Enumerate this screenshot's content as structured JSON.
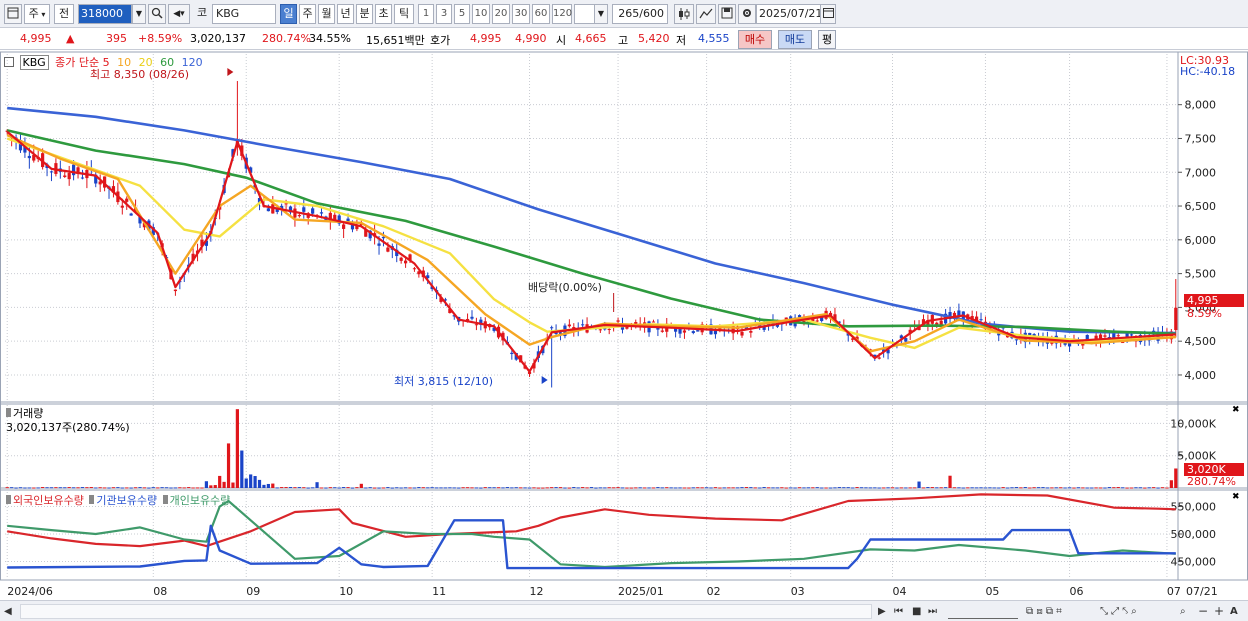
{
  "toolbar": {
    "period_primary": "주",
    "prev_label": "전",
    "code_value": "318000",
    "stock_prefix": "코",
    "stock_name": "KBG",
    "periods": [
      "일",
      "주",
      "월",
      "년",
      "분",
      "초",
      "틱"
    ],
    "active_period": "일",
    "intervals": [
      "1",
      "3",
      "5",
      "10",
      "20",
      "30",
      "60",
      "120"
    ],
    "count_value": "265",
    "count_total": "/600",
    "date_value": "2025/07/21"
  },
  "quote": {
    "price": "4,995",
    "change_arrow": "▲",
    "change": "395",
    "change_pct": "+8.59%",
    "volume": "3,020,137",
    "volume_ratio": "280.74%",
    "turnover_pct": "34.55%",
    "amount": "15,651백만",
    "bid_label": "호가",
    "ask_price": "4,995",
    "bid_price": "4,990",
    "open_label": "시",
    "open": "4,665",
    "high_label": "고",
    "high": "5,420",
    "low_label": "저",
    "low": "4,555",
    "buy_label": "매수",
    "sell_label": "매도",
    "eval_label": "평"
  },
  "price_pane": {
    "tag": "KBG",
    "legend_title": "종가 단순",
    "ma_periods": [
      "5",
      "10",
      "20",
      "60",
      "120"
    ],
    "high_note": "최고 8,350 (08/26)",
    "low_note": "최저 3,815 (12/10)",
    "dividend_note": "배당락(0.00%)",
    "lc": "LC:30.93",
    "hc": "HC:-40.18",
    "current_price": "4,995",
    "current_pct": "8.59%"
  },
  "volume_pane": {
    "title": "거래량",
    "value_note": "3,020,137주(280.74%)",
    "current_value": "3,020K",
    "current_pct": "280.74%"
  },
  "holding_pane": {
    "labels": [
      "외국인보유수량",
      "기관보유수량",
      "개인보유수량"
    ]
  },
  "colors": {
    "up": "#e0161b",
    "down": "#1a44c8",
    "ma5": "#e0161b",
    "ma10": "#f5a623",
    "ma20": "#f5e142",
    "ma60": "#2e9a3e",
    "ma120": "#3a63d6",
    "foreign": "#d9262b",
    "institution": "#2a54d0",
    "individual": "#3f9a6a"
  },
  "chart_data": {
    "type": "candlestick",
    "symbol": "KBG",
    "x_labels": [
      "2024/06",
      "08",
      "09",
      "10",
      "11",
      "12",
      "2025/01",
      "02",
      "03",
      "04",
      "05",
      "06",
      "07",
      "07/21"
    ],
    "price_axis": {
      "ticks": [
        4000,
        4500,
        5000,
        5500,
        6000,
        6500,
        7000,
        7500,
        8000
      ],
      "tick_labels": [
        "4,000",
        "4,500",
        "5,000",
        "5,500",
        "6,000",
        "6,500",
        "7,000",
        "7,500",
        "8,000"
      ],
      "range": [
        3600,
        8750
      ]
    },
    "volume_axis": {
      "ticks": [
        5000,
        10000
      ],
      "tick_labels": [
        "5,000K",
        "10,000K"
      ],
      "range": [
        0,
        13000
      ]
    },
    "holding_axis": {
      "ticks": [
        450000,
        500000,
        550000
      ],
      "tick_labels": [
        "450,000",
        "500,000",
        "550,000"
      ],
      "range": [
        420000,
        580000
      ]
    },
    "month_bar_index": [
      0,
      33,
      54,
      75,
      96,
      118,
      138,
      158,
      177,
      200,
      221,
      240,
      262
    ],
    "ma120": [
      [
        0,
        7950
      ],
      [
        20,
        7820
      ],
      [
        40,
        7620
      ],
      [
        60,
        7380
      ],
      [
        80,
        7150
      ],
      [
        100,
        6900
      ],
      [
        120,
        6450
      ],
      [
        140,
        6050
      ],
      [
        160,
        5650
      ],
      [
        180,
        5360
      ],
      [
        200,
        5040
      ],
      [
        220,
        4760
      ],
      [
        240,
        4640
      ],
      [
        264,
        4620
      ]
    ],
    "ma60": [
      [
        0,
        7620
      ],
      [
        20,
        7320
      ],
      [
        40,
        7120
      ],
      [
        54,
        6920
      ],
      [
        70,
        6540
      ],
      [
        90,
        6280
      ],
      [
        110,
        5900
      ],
      [
        130,
        5500
      ],
      [
        150,
        5130
      ],
      [
        170,
        4820
      ],
      [
        190,
        4720
      ],
      [
        210,
        4730
      ],
      [
        230,
        4710
      ],
      [
        250,
        4640
      ],
      [
        264,
        4610
      ]
    ],
    "ma20": [
      [
        0,
        7500
      ],
      [
        15,
        7150
      ],
      [
        30,
        6800
      ],
      [
        40,
        6150
      ],
      [
        48,
        6050
      ],
      [
        58,
        6600
      ],
      [
        70,
        6500
      ],
      [
        85,
        6200
      ],
      [
        100,
        5800
      ],
      [
        110,
        5120
      ],
      [
        118,
        4780
      ],
      [
        122,
        4640
      ],
      [
        130,
        4680
      ],
      [
        145,
        4750
      ],
      [
        160,
        4720
      ],
      [
        180,
        4820
      ],
      [
        195,
        4550
      ],
      [
        205,
        4400
      ],
      [
        215,
        4700
      ],
      [
        230,
        4580
      ],
      [
        245,
        4500
      ],
      [
        264,
        4560
      ]
    ],
    "ma10": [
      [
        0,
        7550
      ],
      [
        12,
        7200
      ],
      [
        25,
        6900
      ],
      [
        38,
        5500
      ],
      [
        48,
        6500
      ],
      [
        55,
        6800
      ],
      [
        65,
        6300
      ],
      [
        80,
        6250
      ],
      [
        95,
        5700
      ],
      [
        108,
        4900
      ],
      [
        118,
        4450
      ],
      [
        123,
        4560
      ],
      [
        135,
        4760
      ],
      [
        150,
        4720
      ],
      [
        165,
        4700
      ],
      [
        185,
        4900
      ],
      [
        195,
        4350
      ],
      [
        205,
        4500
      ],
      [
        215,
        4820
      ],
      [
        230,
        4510
      ],
      [
        245,
        4470
      ],
      [
        264,
        4560
      ]
    ],
    "ma5": [
      [
        0,
        7600
      ],
      [
        10,
        7050
      ],
      [
        20,
        6950
      ],
      [
        34,
        6100
      ],
      [
        38,
        5300
      ],
      [
        46,
        6100
      ],
      [
        52,
        7450
      ],
      [
        58,
        6500
      ],
      [
        70,
        6350
      ],
      [
        80,
        6200
      ],
      [
        92,
        5650
      ],
      [
        102,
        4820
      ],
      [
        110,
        4720
      ],
      [
        118,
        4050
      ],
      [
        123,
        4630
      ],
      [
        135,
        4740
      ],
      [
        150,
        4700
      ],
      [
        165,
        4650
      ],
      [
        178,
        4800
      ],
      [
        186,
        4880
      ],
      [
        196,
        4250
      ],
      [
        208,
        4800
      ],
      [
        216,
        4880
      ],
      [
        228,
        4560
      ],
      [
        240,
        4500
      ],
      [
        252,
        4550
      ],
      [
        264,
        4600
      ]
    ],
    "candles_summary": "265 daily candles; last close 4,995 (+8.59%), high 5,420, low 4,555, period high 8,350 (08/26), period low 3,815 (12/10)"
  }
}
